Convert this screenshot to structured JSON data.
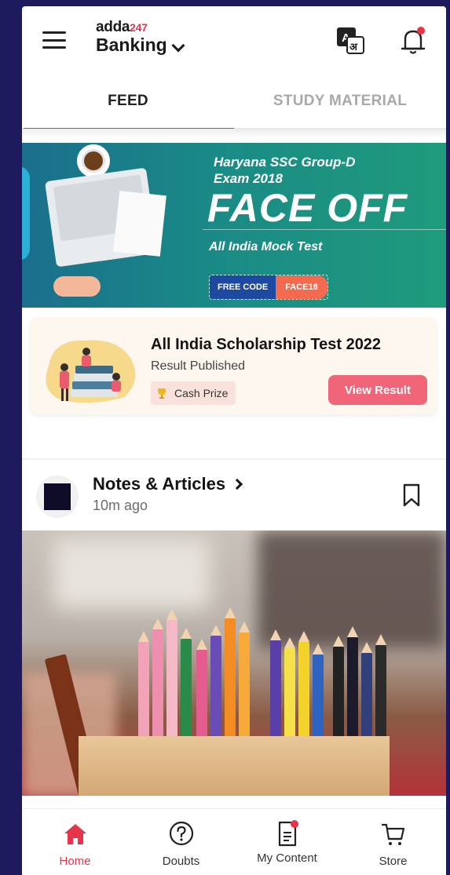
{
  "header": {
    "logo_text": "adda",
    "logo_accent": "247",
    "category": "Banking",
    "icons": {
      "menu": "hamburger-icon",
      "language": "translate-icon",
      "notifications": "bell-icon"
    }
  },
  "tabs": [
    {
      "label": "FEED",
      "active": true
    },
    {
      "label": "STUDY MATERIAL",
      "active": false
    }
  ],
  "banner": {
    "line1": "Haryana SSC Group-D",
    "line2": "Exam 2018",
    "headline": "FACE OFF",
    "subline": "All India Mock Test",
    "code_label": "FREE CODE",
    "code_value": "FACE18"
  },
  "scholarship": {
    "title": "All India Scholarship Test 2022",
    "subtitle": "Result Published",
    "badge": "Cash Prize",
    "button": "View Result"
  },
  "post": {
    "title": "Notes & Articles",
    "time": "10m ago"
  },
  "bottom_nav": [
    {
      "label": "Home",
      "icon": "home-icon",
      "active": true
    },
    {
      "label": "Doubts",
      "icon": "question-icon",
      "active": false
    },
    {
      "label": "My Content",
      "icon": "document-icon",
      "active": false
    },
    {
      "label": "Store",
      "icon": "cart-icon",
      "active": false
    }
  ],
  "colors": {
    "accent": "#e8344a",
    "background": "#1e1a5e",
    "button": "#f06577"
  }
}
